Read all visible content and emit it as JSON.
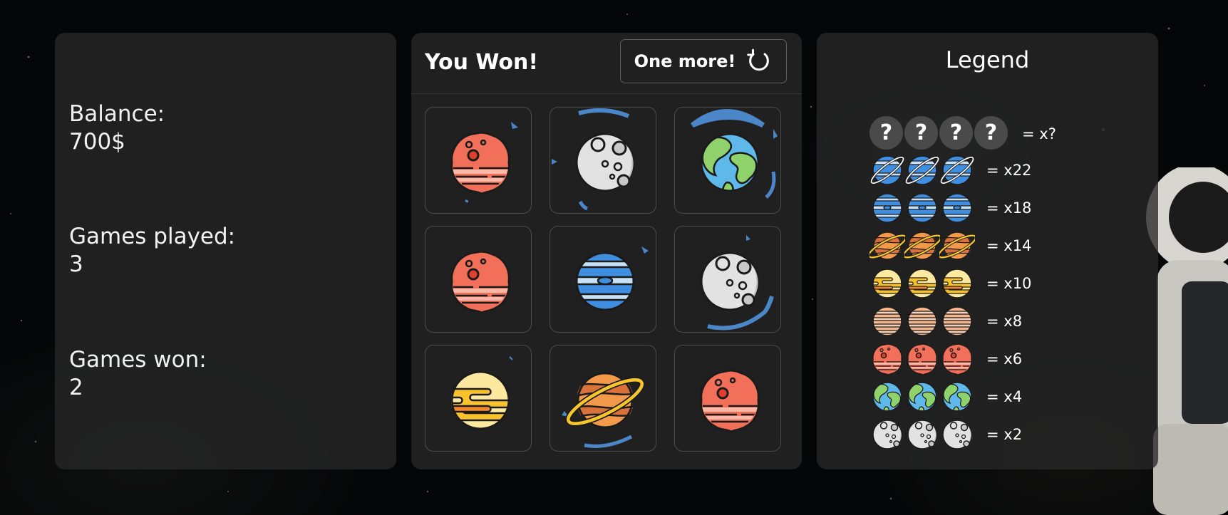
{
  "stats": {
    "balance_label": "Balance:",
    "balance_value": "700$",
    "played_label": "Games played:",
    "played_value": "3",
    "won_label": "Games won:",
    "won_value": "2"
  },
  "game": {
    "result": "You Won!",
    "one_more_label": "One more!",
    "grid": [
      [
        "mars",
        "moon",
        "earth"
      ],
      [
        "mars",
        "neptune",
        "moon"
      ],
      [
        "venus",
        "saturn",
        "mars"
      ]
    ]
  },
  "legend": {
    "title": "Legend",
    "unknown": {
      "symbol": "?",
      "multiplier": "= x?"
    },
    "rows": [
      {
        "planet": "uranus",
        "multiplier": "= x22"
      },
      {
        "planet": "neptune",
        "multiplier": "= x18"
      },
      {
        "planet": "saturn",
        "multiplier": "= x14"
      },
      {
        "planet": "venus",
        "multiplier": "= x10"
      },
      {
        "planet": "jupiter",
        "multiplier": "= x8"
      },
      {
        "planet": "mars",
        "multiplier": "= x6"
      },
      {
        "planet": "earth",
        "multiplier": "= x4"
      },
      {
        "planet": "moon",
        "multiplier": "= x2"
      }
    ]
  },
  "colors": {
    "panel": "#2a2a2a",
    "accent_swoosh": "#4a86c8"
  }
}
